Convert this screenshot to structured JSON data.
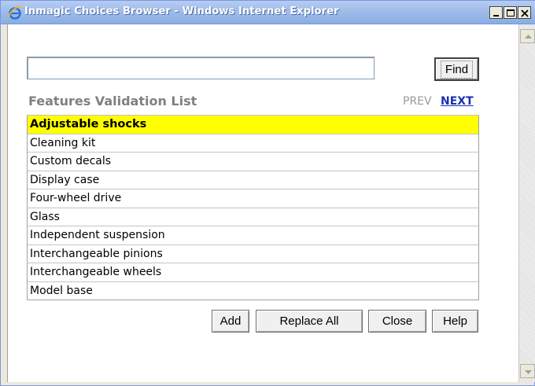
{
  "window": {
    "title": "Inmagic Choices Browser - Windows Internet Explorer",
    "icon": "internet-explorer-icon",
    "controls": [
      "minimize-icon",
      "maximize-icon",
      "close-icon"
    ]
  },
  "search": {
    "value": "",
    "placeholder": "",
    "find_label": "Find"
  },
  "list": {
    "title": "Features Validation List",
    "prev_label": "PREV",
    "next_label": "NEXT",
    "selected_index": 0,
    "items": [
      "Adjustable shocks",
      "Cleaning kit",
      "Custom decals",
      "Display case",
      "Four-wheel drive",
      "Glass",
      "Independent suspension",
      "Interchangeable pinions",
      "Interchangeable wheels",
      "Model base"
    ]
  },
  "actions": {
    "add_label": "Add",
    "replace_all_label": "Replace All",
    "close_label": "Close",
    "help_label": "Help"
  },
  "colors": {
    "selected_row": "#ffff00",
    "title_text": "#808080",
    "link": "#1a30b0",
    "prev_disabled": "#999999"
  }
}
